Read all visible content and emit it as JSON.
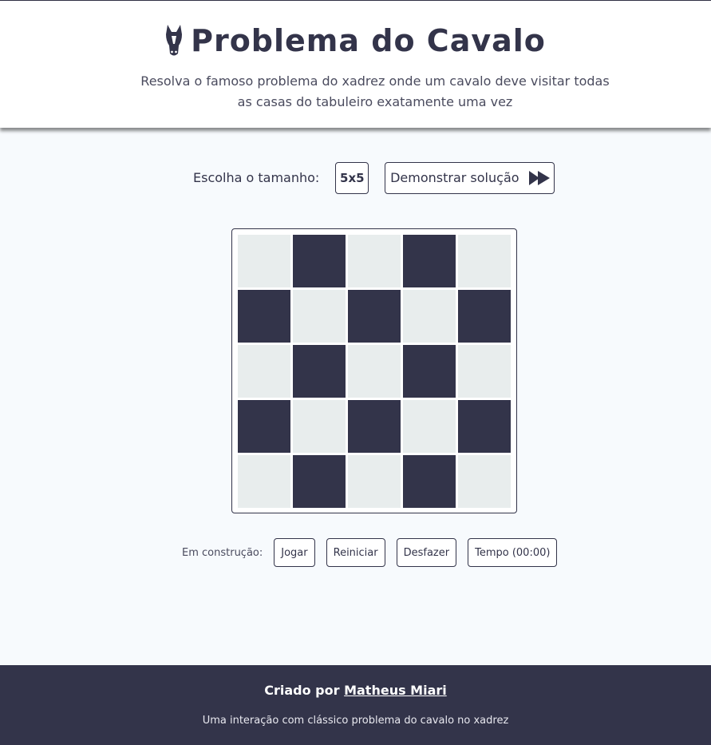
{
  "header": {
    "title": "Problema do Cavalo",
    "subtitle_line1": "Resolva o famoso problema do xadrez onde um cavalo deve visitar todas",
    "subtitle_line2": "as casas do tabuleiro exatamente uma vez"
  },
  "controls": {
    "size_label": "Escolha o tamanho:",
    "size_value": "5x5",
    "demo_label": "Demonstrar solução"
  },
  "board": {
    "rows": 5,
    "cols": 5,
    "colors": {
      "light": "#e8eded",
      "dark": "#33344a"
    }
  },
  "construction": {
    "label": "Em construção:",
    "play": "Jogar",
    "restart": "Reiniciar",
    "undo": "Desfazer",
    "timer": "Tempo (00:00)"
  },
  "footer": {
    "credit_prefix": "Criado por",
    "author": "Matheus Miari",
    "description": "Uma interação com clássico problema do cavalo no xadrez"
  },
  "colors": {
    "accent": "#33344a",
    "background": "#f7fafd"
  },
  "icons": {
    "title": "horse-head-icon",
    "demo": "fast-forward-icon"
  }
}
